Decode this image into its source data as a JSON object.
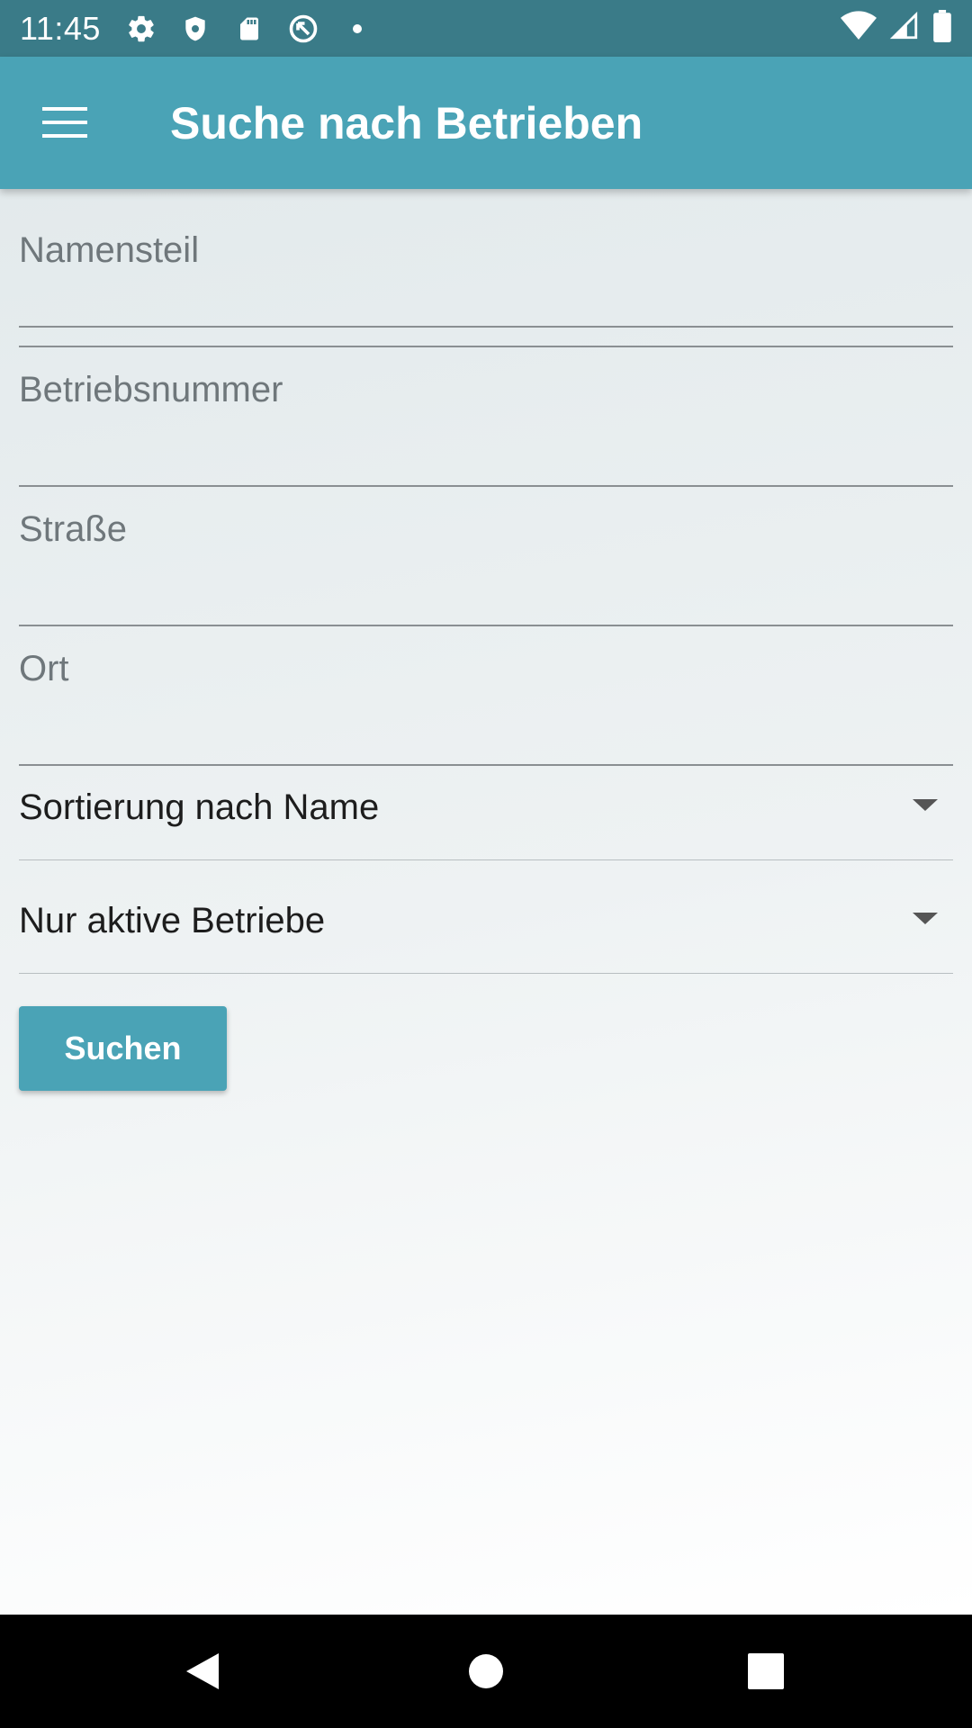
{
  "status_bar": {
    "time": "11:45",
    "left_icons": [
      "settings-icon",
      "shield-icon",
      "sd-card-icon",
      "data-saver-icon",
      "notification-dot-icon"
    ],
    "right_icons": [
      "wifi-icon",
      "cell-signal-icon",
      "battery-icon"
    ]
  },
  "app_bar": {
    "title": "Suche nach Betrieben",
    "menu_icon": "menu-icon"
  },
  "form": {
    "name_placeholder": "Namensteil",
    "name_value": "",
    "number_placeholder": "Betriebsnummer",
    "number_value": "",
    "street_placeholder": "Straße",
    "street_value": "",
    "city_placeholder": "Ort",
    "city_value": "",
    "sort_selected": "Sortierung nach Name",
    "status_selected": "Nur aktive Betriebe",
    "search_label": "Suchen"
  },
  "nav_bar": {
    "icons": [
      "back-icon",
      "home-icon",
      "recents-icon"
    ]
  },
  "colors": {
    "status_bar": "#3a7b88",
    "primary": "#4aa3b6",
    "background_top": "#e3eaec",
    "background_bottom": "#ffffff"
  }
}
